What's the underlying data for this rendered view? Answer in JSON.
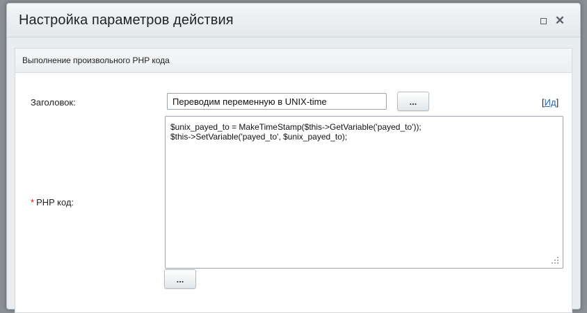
{
  "dialog": {
    "title": "Настройка параметров действия",
    "maximize_icon": "maximize-icon",
    "close_icon": "close-icon",
    "close_glyph": "✕"
  },
  "section": {
    "title": "Выполнение произвольного PHP кода"
  },
  "fields": {
    "title_label": "Заголовок:",
    "title_value": "Переводим переменную в UNIX-time",
    "title_button": "...",
    "id_link_open": "[",
    "id_link": "Ид",
    "id_link_close": "]",
    "php_required_mark": "*",
    "php_label": "PHP код:",
    "php_code_line1": "$unix_payed_to = MakeTimeStamp($this->GetVariable('payed_to'));",
    "php_code_line2": "$this->SetVariable('payed_to', $unix_payed_to);",
    "php_button": "..."
  },
  "colors": {
    "required": "#dd1111",
    "link": "#2a64b4"
  }
}
